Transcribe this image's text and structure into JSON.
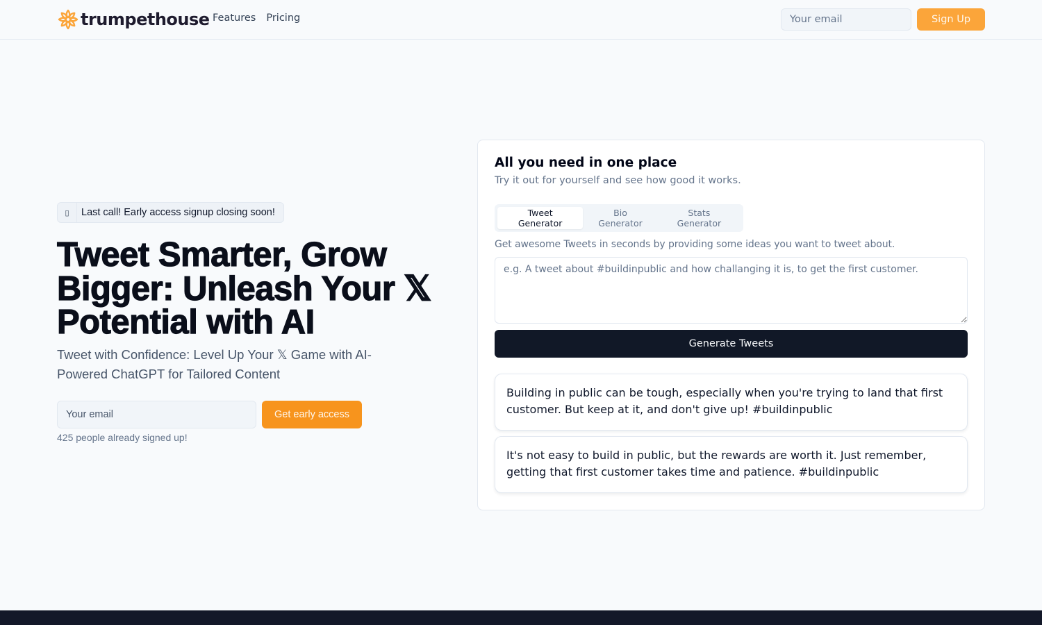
{
  "brand": {
    "name": "trumpethouse",
    "logo_icon": "sun-flower-icon",
    "accent_color": "#f7941d",
    "dark_color": "#111827"
  },
  "nav": {
    "links": [
      {
        "label": "Features"
      },
      {
        "label": "Pricing"
      }
    ],
    "email_placeholder": "Your email",
    "signup_label": "Sign Up"
  },
  "hero": {
    "announcement_icon": "megaphone-icon",
    "announcement_icon_glyph": "▯",
    "announcement": "Last call! Early access signup closing soon!",
    "title": "Tweet Smarter, Grow Bigger: Unleash Your 𝕏 Potential with AI",
    "subtitle": "Tweet with Confidence: Level Up Your 𝕏 Game with AI-Powered ChatGPT for Tailored Content",
    "email_placeholder": "Your email",
    "cta_label": "Get early access",
    "signup_count_text": "425 people already signed up!"
  },
  "demo": {
    "title": "All you need in one place",
    "subtitle": "Try it out for yourself and see how good it works.",
    "tabs": [
      {
        "label": "Tweet Generator",
        "active": true
      },
      {
        "label": "Bio Generator",
        "active": false
      },
      {
        "label": "Stats Generator",
        "active": false
      }
    ],
    "description": "Get awesome Tweets in seconds by providing some ideas you want to tweet about.",
    "prompt_placeholder": "e.g. A tweet about #buildinpublic and how challanging it is, to get the first customer.",
    "prompt_value": "",
    "generate_label": "Generate Tweets",
    "results": [
      {
        "text": "Building in public can be tough, especially when you're trying to land that first customer. But keep at it, and don't give up! #buildinpublic"
      },
      {
        "text": "It's not easy to build in public, but the rewards are worth it. Just remember, getting that first customer takes time and patience. #buildinpublic"
      }
    ]
  }
}
